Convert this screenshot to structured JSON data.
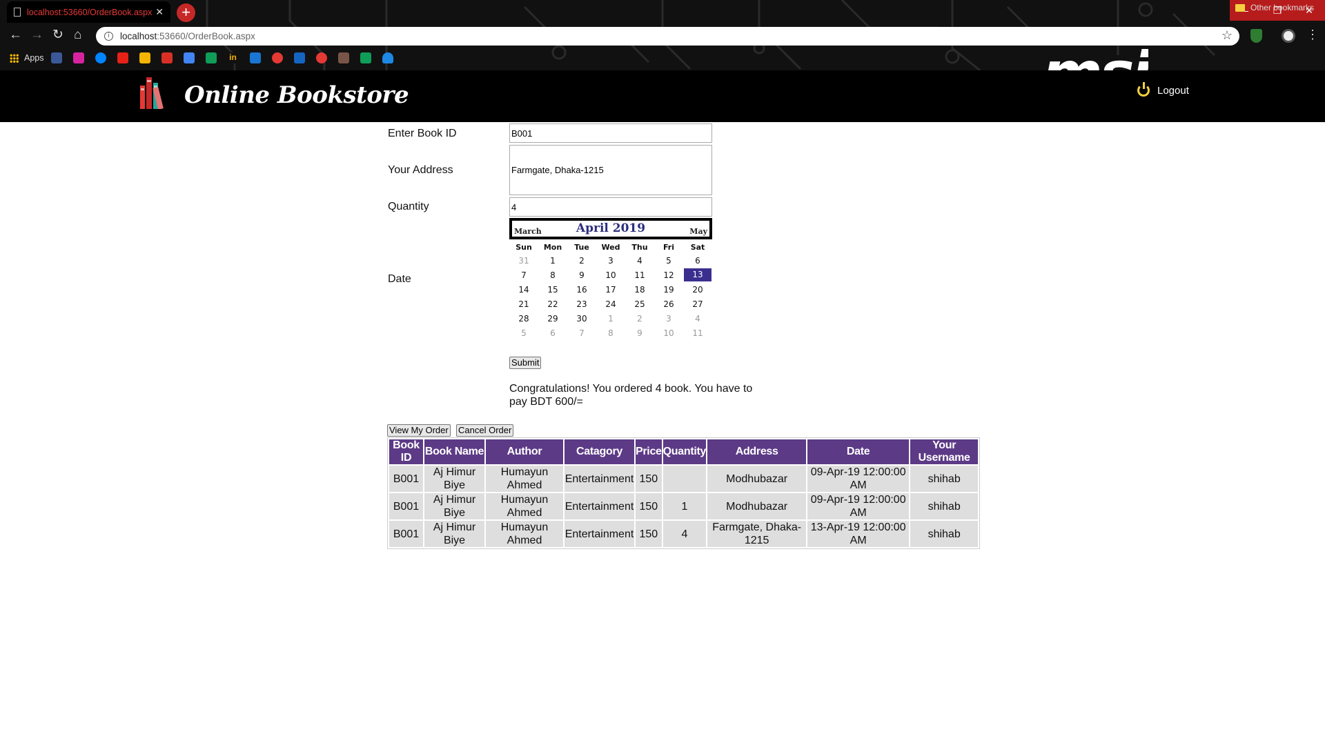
{
  "browser": {
    "tab_title": "localhost:53660/OrderBook.aspx",
    "url_host": "localhost",
    "url_path": ":53660/OrderBook.aspx",
    "apps_label": "Apps",
    "other_bookmarks": "Other bookmarks",
    "brand_logo": "msi"
  },
  "header": {
    "site_title": "Online Bookstore",
    "logout_label": "Logout"
  },
  "form": {
    "book_id_label": "Enter Book ID",
    "book_id_value": "B001",
    "address_label": "Your Address",
    "address_value": "Farmgate, Dhaka-1215",
    "quantity_label": "Quantity",
    "quantity_value": "4",
    "date_label": "Date",
    "submit_label": "Submit"
  },
  "calendar": {
    "prev_month": "March",
    "title": "April 2019",
    "next_month": "May",
    "weekdays": [
      "Sun",
      "Mon",
      "Tue",
      "Wed",
      "Thu",
      "Fri",
      "Sat"
    ],
    "selected_day": "13",
    "weeks": [
      [
        "31",
        "1",
        "2",
        "3",
        "4",
        "5",
        "6"
      ],
      [
        "7",
        "8",
        "9",
        "10",
        "11",
        "12",
        "13"
      ],
      [
        "14",
        "15",
        "16",
        "17",
        "18",
        "19",
        "20"
      ],
      [
        "21",
        "22",
        "23",
        "24",
        "25",
        "26",
        "27"
      ],
      [
        "28",
        "29",
        "30",
        "1",
        "2",
        "3",
        "4"
      ],
      [
        "5",
        "6",
        "7",
        "8",
        "9",
        "10",
        "11"
      ]
    ]
  },
  "message": "Congratulations! You ordered 4 book. You have to pay BDT 600/=",
  "actions": {
    "view_orders": "View My Order",
    "cancel_order": "Cancel Order"
  },
  "orders": {
    "columns": [
      "Book ID",
      "Book Name",
      "Author",
      "Catagory",
      "Price",
      "Quantity",
      "Address",
      "Date",
      "Your Username"
    ],
    "rows": [
      [
        "B001",
        "Aj Himur Biye",
        "Humayun Ahmed",
        "Entertainment",
        "150",
        "",
        "Modhubazar",
        "09-Apr-19 12:00:00 AM",
        "shihab"
      ],
      [
        "B001",
        "Aj Himur Biye",
        "Humayun Ahmed",
        "Entertainment",
        "150",
        "1",
        "Modhubazar",
        "09-Apr-19 12:00:00 AM",
        "shihab"
      ],
      [
        "B001",
        "Aj Himur Biye",
        "Humayun Ahmed",
        "Entertainment",
        "150",
        "4",
        "Farmgate, Dhaka-1215",
        "13-Apr-19 12:00:00 AM",
        "shihab"
      ]
    ]
  },
  "colors": {
    "header_bg": "#000000",
    "table_header": "#5c3a86",
    "calendar_selected": "#3a2f8f",
    "tab_text": "#e53935"
  }
}
